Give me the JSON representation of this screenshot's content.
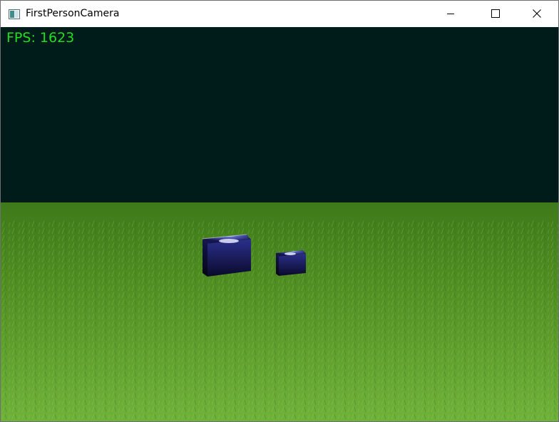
{
  "window": {
    "title": "FirstPersonCamera",
    "icon": "app-window-icon",
    "controls": {
      "minimize_icon": "minimize-icon",
      "maximize_icon": "maximize-icon",
      "close_icon": "close-icon"
    }
  },
  "scene": {
    "fps_text": "FPS: 1623",
    "colors": {
      "sky": "#001c1a",
      "grass_horizon": "#3e7a1a",
      "grass_near": "#6fb23a",
      "fps_text": "#22dd22",
      "cube_face": "#1a1a66",
      "cube_highlight": "#e8ecff"
    }
  }
}
